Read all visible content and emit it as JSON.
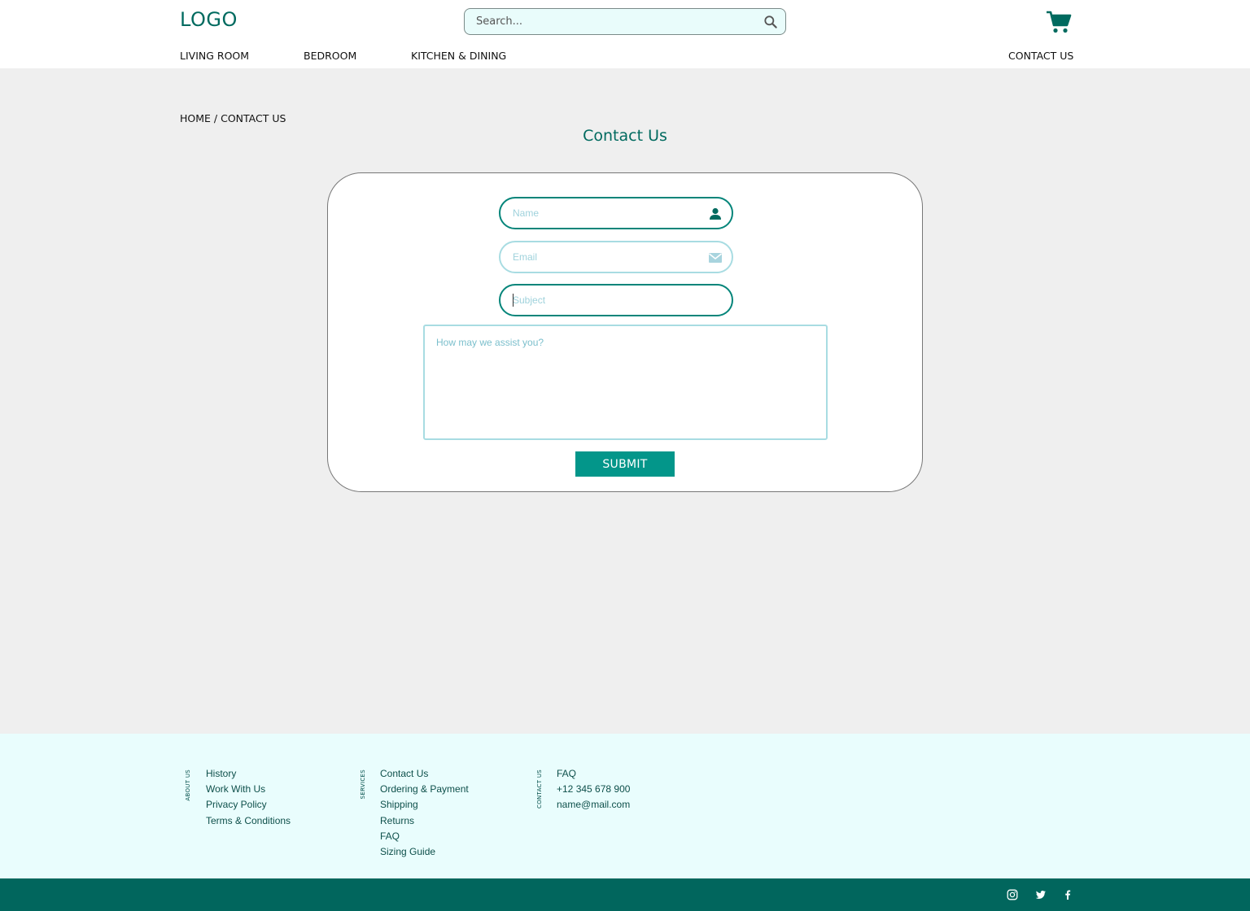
{
  "header": {
    "logo": "LOGO",
    "search_placeholder": "Search...",
    "cart_icon": "shopping-cart-icon",
    "nav": [
      {
        "label": "LIVING ROOM"
      },
      {
        "label": "BEDROOM"
      },
      {
        "label": "KITCHEN & DINING"
      },
      {
        "label": "CONTACT US"
      }
    ]
  },
  "breadcrumb": {
    "home": "HOME",
    "separator": " / ",
    "current": "CONTACT US"
  },
  "page_title": "Contact Us",
  "form": {
    "name_placeholder": "Name",
    "email_placeholder": "Email",
    "subject_placeholder": "Subject",
    "message_placeholder": "How may we assist you?",
    "submit_label": "SUBMIT"
  },
  "footer": {
    "columns": [
      {
        "label": "ABOUT US",
        "items": [
          "History",
          "Work With Us",
          "Privacy Policy",
          "Terms & Conditions"
        ]
      },
      {
        "label": "SERVICES",
        "items": [
          "Contact Us",
          "Ordering & Payment",
          "Shipping",
          "Returns",
          "FAQ",
          "Sizing Guide"
        ]
      },
      {
        "label": "CONTACT US",
        "items": [
          "FAQ",
          "+12 345 678 900",
          "name@mail.com"
        ]
      }
    ],
    "social_icons": [
      "instagram-icon",
      "twitter-icon",
      "facebook-icon"
    ]
  },
  "colors": {
    "brand": "#006a5f",
    "accent": "#03968a",
    "footer_bg": "#e9fdfd",
    "bottom_bar": "#01665d"
  }
}
